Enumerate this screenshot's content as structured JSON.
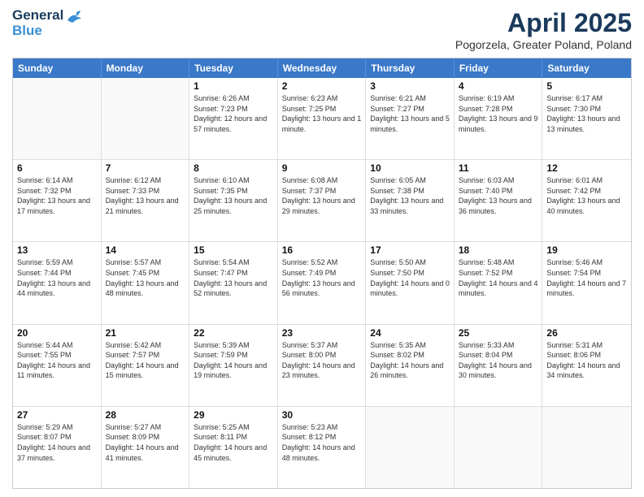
{
  "header": {
    "logo_general": "General",
    "logo_blue": "Blue",
    "title": "April 2025",
    "location": "Pogorzela, Greater Poland, Poland"
  },
  "days_of_week": [
    "Sunday",
    "Monday",
    "Tuesday",
    "Wednesday",
    "Thursday",
    "Friday",
    "Saturday"
  ],
  "weeks": [
    [
      {
        "day": "",
        "info": ""
      },
      {
        "day": "",
        "info": ""
      },
      {
        "day": "1",
        "info": "Sunrise: 6:26 AM\nSunset: 7:23 PM\nDaylight: 12 hours and 57 minutes."
      },
      {
        "day": "2",
        "info": "Sunrise: 6:23 AM\nSunset: 7:25 PM\nDaylight: 13 hours and 1 minute."
      },
      {
        "day": "3",
        "info": "Sunrise: 6:21 AM\nSunset: 7:27 PM\nDaylight: 13 hours and 5 minutes."
      },
      {
        "day": "4",
        "info": "Sunrise: 6:19 AM\nSunset: 7:28 PM\nDaylight: 13 hours and 9 minutes."
      },
      {
        "day": "5",
        "info": "Sunrise: 6:17 AM\nSunset: 7:30 PM\nDaylight: 13 hours and 13 minutes."
      }
    ],
    [
      {
        "day": "6",
        "info": "Sunrise: 6:14 AM\nSunset: 7:32 PM\nDaylight: 13 hours and 17 minutes."
      },
      {
        "day": "7",
        "info": "Sunrise: 6:12 AM\nSunset: 7:33 PM\nDaylight: 13 hours and 21 minutes."
      },
      {
        "day": "8",
        "info": "Sunrise: 6:10 AM\nSunset: 7:35 PM\nDaylight: 13 hours and 25 minutes."
      },
      {
        "day": "9",
        "info": "Sunrise: 6:08 AM\nSunset: 7:37 PM\nDaylight: 13 hours and 29 minutes."
      },
      {
        "day": "10",
        "info": "Sunrise: 6:05 AM\nSunset: 7:38 PM\nDaylight: 13 hours and 33 minutes."
      },
      {
        "day": "11",
        "info": "Sunrise: 6:03 AM\nSunset: 7:40 PM\nDaylight: 13 hours and 36 minutes."
      },
      {
        "day": "12",
        "info": "Sunrise: 6:01 AM\nSunset: 7:42 PM\nDaylight: 13 hours and 40 minutes."
      }
    ],
    [
      {
        "day": "13",
        "info": "Sunrise: 5:59 AM\nSunset: 7:44 PM\nDaylight: 13 hours and 44 minutes."
      },
      {
        "day": "14",
        "info": "Sunrise: 5:57 AM\nSunset: 7:45 PM\nDaylight: 13 hours and 48 minutes."
      },
      {
        "day": "15",
        "info": "Sunrise: 5:54 AM\nSunset: 7:47 PM\nDaylight: 13 hours and 52 minutes."
      },
      {
        "day": "16",
        "info": "Sunrise: 5:52 AM\nSunset: 7:49 PM\nDaylight: 13 hours and 56 minutes."
      },
      {
        "day": "17",
        "info": "Sunrise: 5:50 AM\nSunset: 7:50 PM\nDaylight: 14 hours and 0 minutes."
      },
      {
        "day": "18",
        "info": "Sunrise: 5:48 AM\nSunset: 7:52 PM\nDaylight: 14 hours and 4 minutes."
      },
      {
        "day": "19",
        "info": "Sunrise: 5:46 AM\nSunset: 7:54 PM\nDaylight: 14 hours and 7 minutes."
      }
    ],
    [
      {
        "day": "20",
        "info": "Sunrise: 5:44 AM\nSunset: 7:55 PM\nDaylight: 14 hours and 11 minutes."
      },
      {
        "day": "21",
        "info": "Sunrise: 5:42 AM\nSunset: 7:57 PM\nDaylight: 14 hours and 15 minutes."
      },
      {
        "day": "22",
        "info": "Sunrise: 5:39 AM\nSunset: 7:59 PM\nDaylight: 14 hours and 19 minutes."
      },
      {
        "day": "23",
        "info": "Sunrise: 5:37 AM\nSunset: 8:00 PM\nDaylight: 14 hours and 23 minutes."
      },
      {
        "day": "24",
        "info": "Sunrise: 5:35 AM\nSunset: 8:02 PM\nDaylight: 14 hours and 26 minutes."
      },
      {
        "day": "25",
        "info": "Sunrise: 5:33 AM\nSunset: 8:04 PM\nDaylight: 14 hours and 30 minutes."
      },
      {
        "day": "26",
        "info": "Sunrise: 5:31 AM\nSunset: 8:06 PM\nDaylight: 14 hours and 34 minutes."
      }
    ],
    [
      {
        "day": "27",
        "info": "Sunrise: 5:29 AM\nSunset: 8:07 PM\nDaylight: 14 hours and 37 minutes."
      },
      {
        "day": "28",
        "info": "Sunrise: 5:27 AM\nSunset: 8:09 PM\nDaylight: 14 hours and 41 minutes."
      },
      {
        "day": "29",
        "info": "Sunrise: 5:25 AM\nSunset: 8:11 PM\nDaylight: 14 hours and 45 minutes."
      },
      {
        "day": "30",
        "info": "Sunrise: 5:23 AM\nSunset: 8:12 PM\nDaylight: 14 hours and 48 minutes."
      },
      {
        "day": "",
        "info": ""
      },
      {
        "day": "",
        "info": ""
      },
      {
        "day": "",
        "info": ""
      }
    ]
  ]
}
